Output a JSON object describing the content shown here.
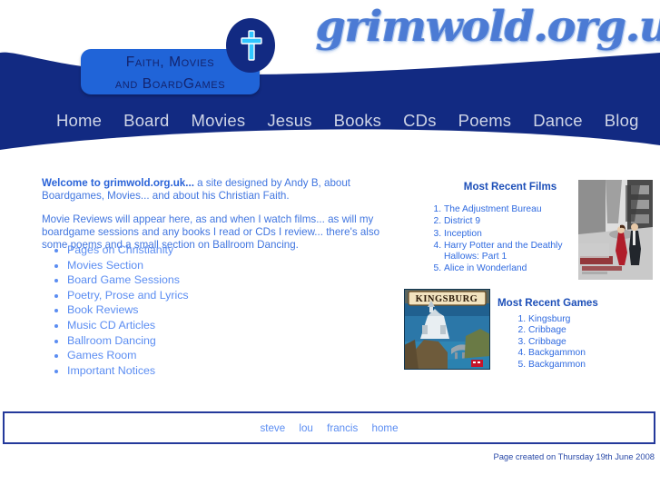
{
  "header": {
    "logo_text": "grimwold.org.uk",
    "tagline_line1": "Faith, Movies",
    "tagline_line2": "and BoardGames",
    "cross_icon": "cross-icon",
    "band_color": "#122a82",
    "tagline_bg": "#2064d8",
    "logo_color": "#4c7bd4"
  },
  "nav": {
    "items": [
      {
        "label": "Home"
      },
      {
        "label": "Board"
      },
      {
        "label": "Movies"
      },
      {
        "label": "Jesus"
      },
      {
        "label": "Books"
      },
      {
        "label": "CDs"
      },
      {
        "label": "Poems"
      },
      {
        "label": "Dance"
      },
      {
        "label": "Blog"
      }
    ]
  },
  "intro": {
    "welcome_link": "Welcome to grimwold.org.uk...",
    "paragraph1_rest": " a site designed by Andy B, about Boardgames, Movies... and about his Christian Faith.",
    "paragraph2": "Movie Reviews will appear here, as and when I watch films... as will my boardgame sessions and any books I read or CDs I review... there's also some poems and a small section on Ballroom Dancing."
  },
  "section_links": [
    {
      "label": "Pages on Christianity"
    },
    {
      "label": "Movies Section"
    },
    {
      "label": "Board Game Sessions"
    },
    {
      "label": "Poetry, Prose and Lyrics"
    },
    {
      "label": "Book Reviews"
    },
    {
      "label": "Music CD Articles"
    },
    {
      "label": "Ballroom Dancing"
    },
    {
      "label": "Games Room"
    },
    {
      "label": "Important Notices"
    }
  ],
  "films": {
    "heading": "Most Recent Films",
    "items": [
      {
        "label": "The Adjustment Bureau"
      },
      {
        "label": "District 9"
      },
      {
        "label": "Inception"
      },
      {
        "label": "Harry Potter and the Deathly Hallows: Part 1"
      },
      {
        "label": "Alice in Wonderland"
      }
    ],
    "poster_alt": "The Adjustment Bureau poster"
  },
  "games": {
    "heading": "Most Recent Games",
    "box_title": "KINGSBURG",
    "items": [
      {
        "label": "Kingsburg"
      },
      {
        "label": "Cribbage"
      },
      {
        "label": "Cribbage"
      },
      {
        "label": "Backgammon"
      },
      {
        "label": "Backgammon"
      }
    ]
  },
  "footer": {
    "links": [
      {
        "label": "steve"
      },
      {
        "label": "lou"
      },
      {
        "label": "francis"
      },
      {
        "label": "home"
      }
    ],
    "page_created": "Page created on Thursday 19th June 2008"
  }
}
